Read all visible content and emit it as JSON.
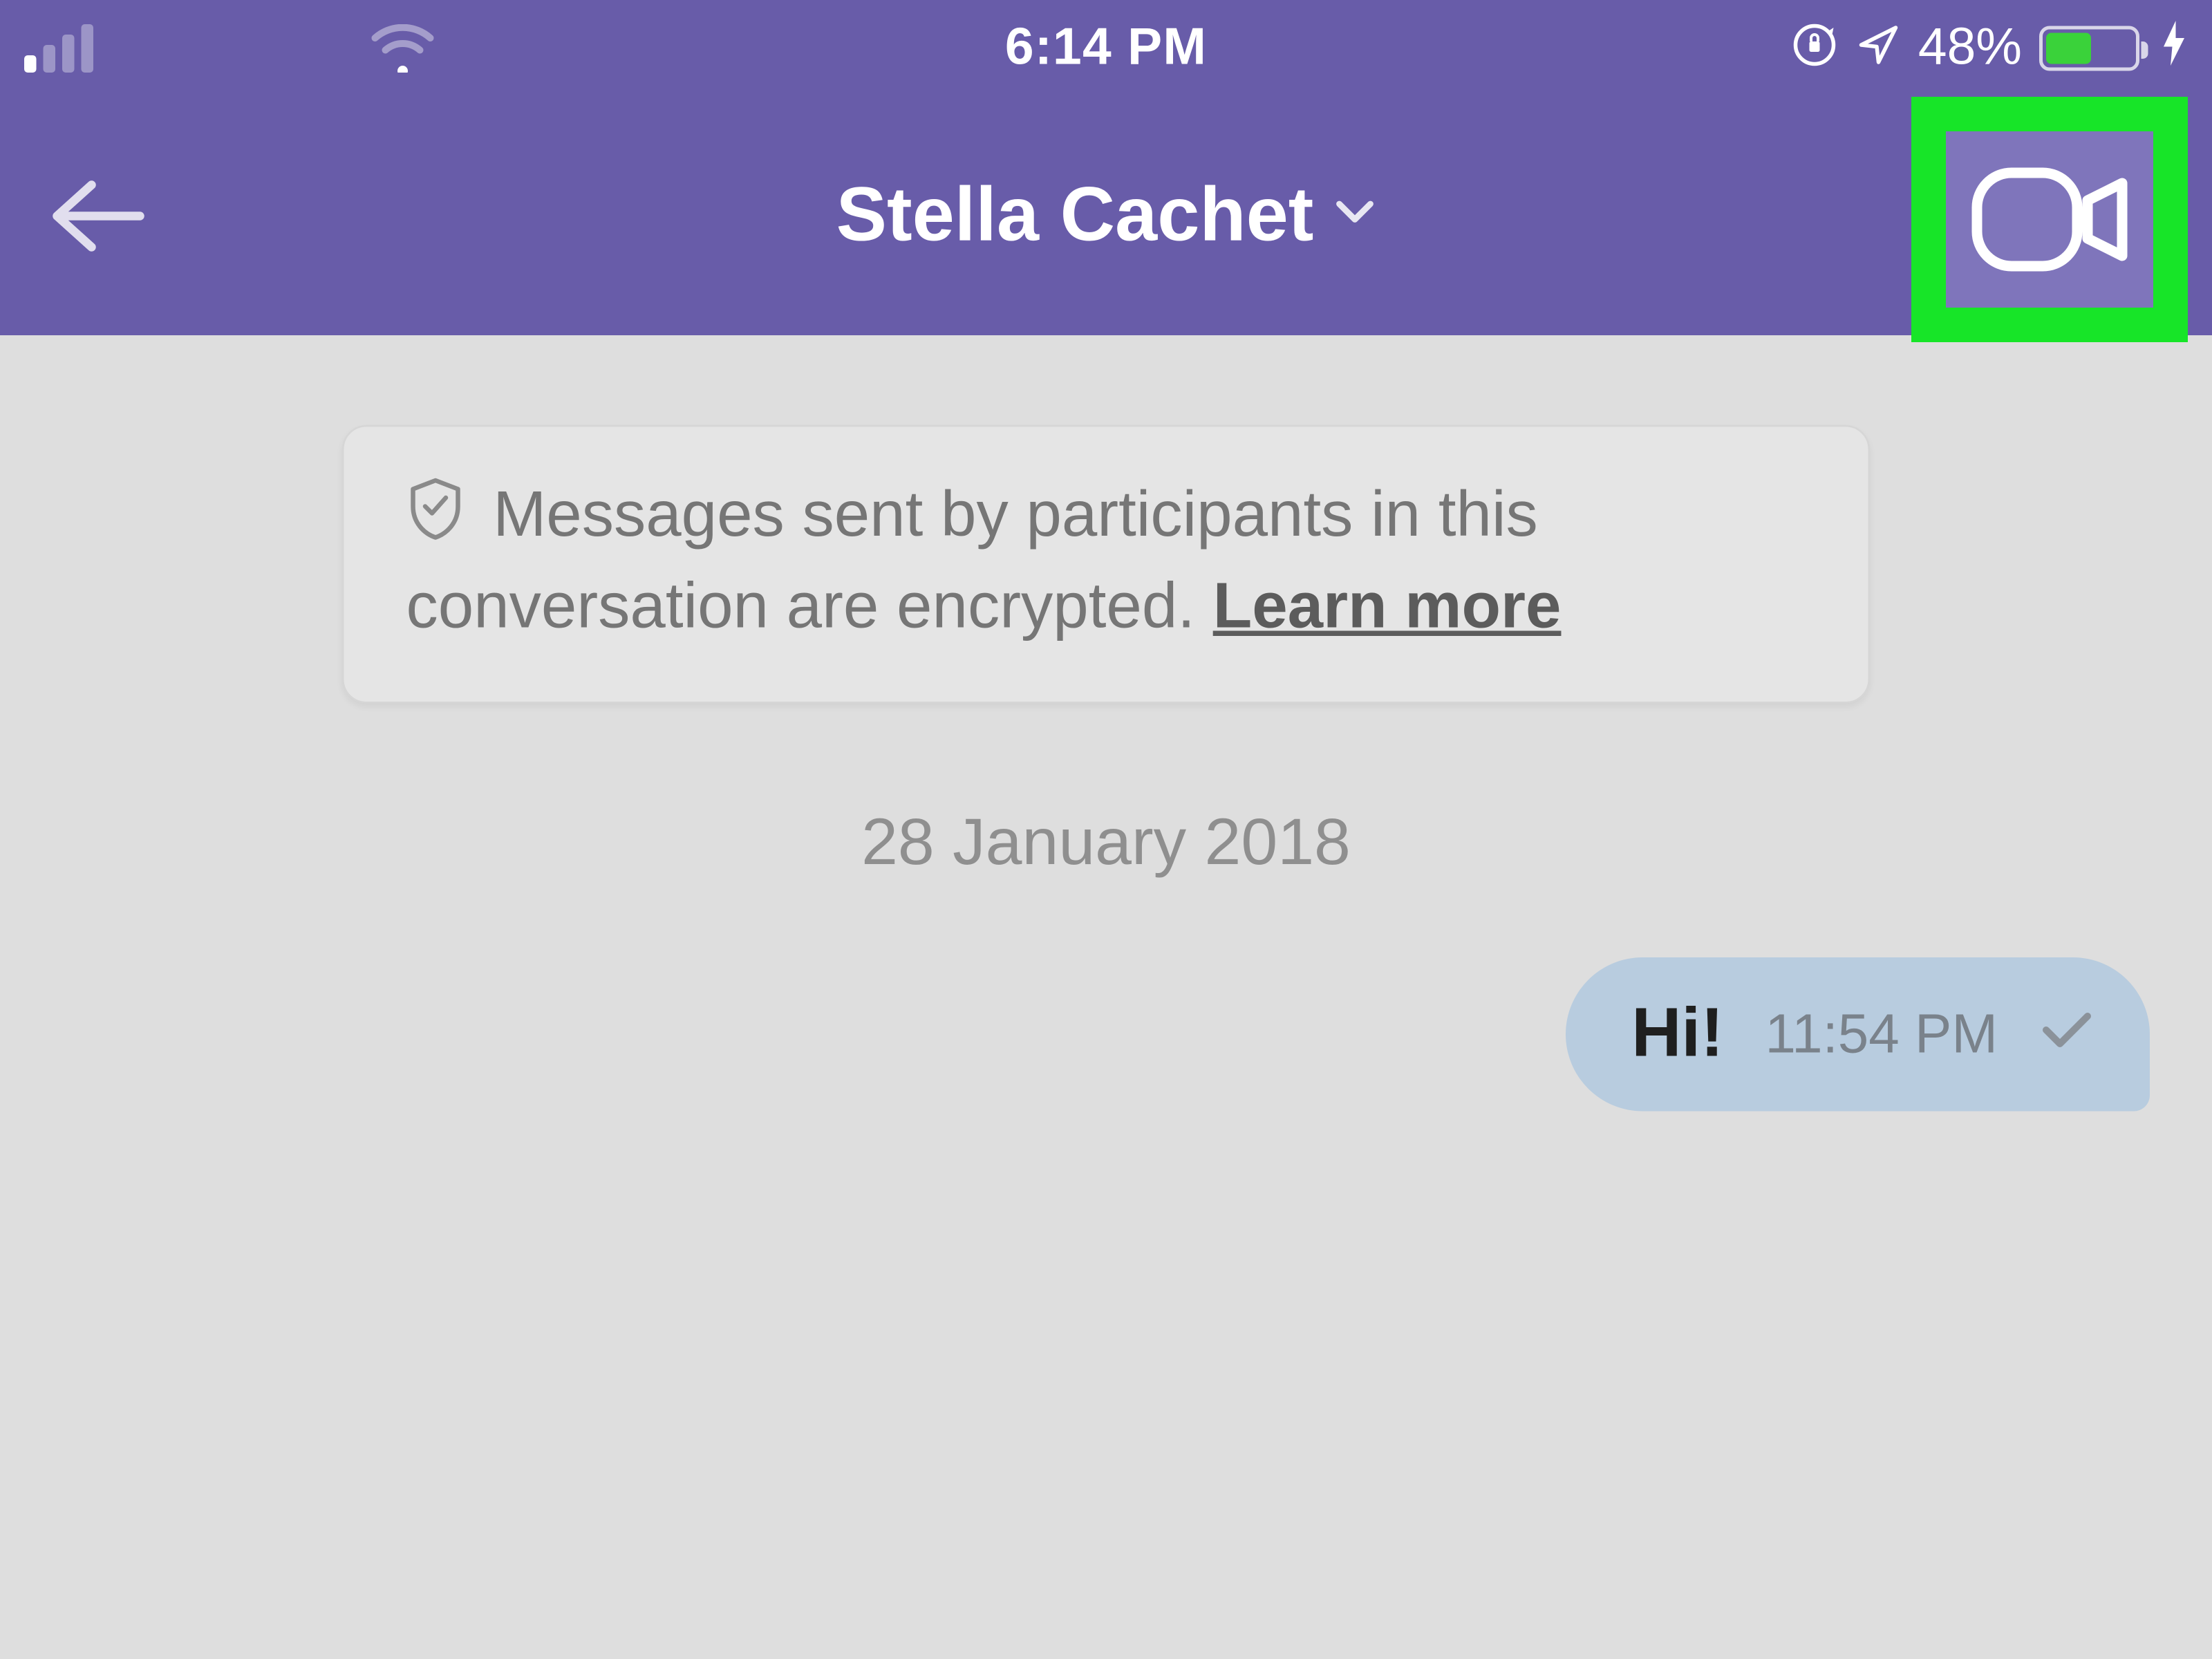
{
  "statusbar": {
    "time": "6:14 PM",
    "battery_percent": "48%"
  },
  "header": {
    "contact_name": "Stella Cachet"
  },
  "encryption_banner": {
    "text_part1": "Messages sent by participants in this conversation are encrypted. ",
    "learn_more": "Learn more"
  },
  "date_separator": "28 January 2018",
  "messages": [
    {
      "text": "Hi!",
      "time": "11:54 PM"
    }
  ]
}
